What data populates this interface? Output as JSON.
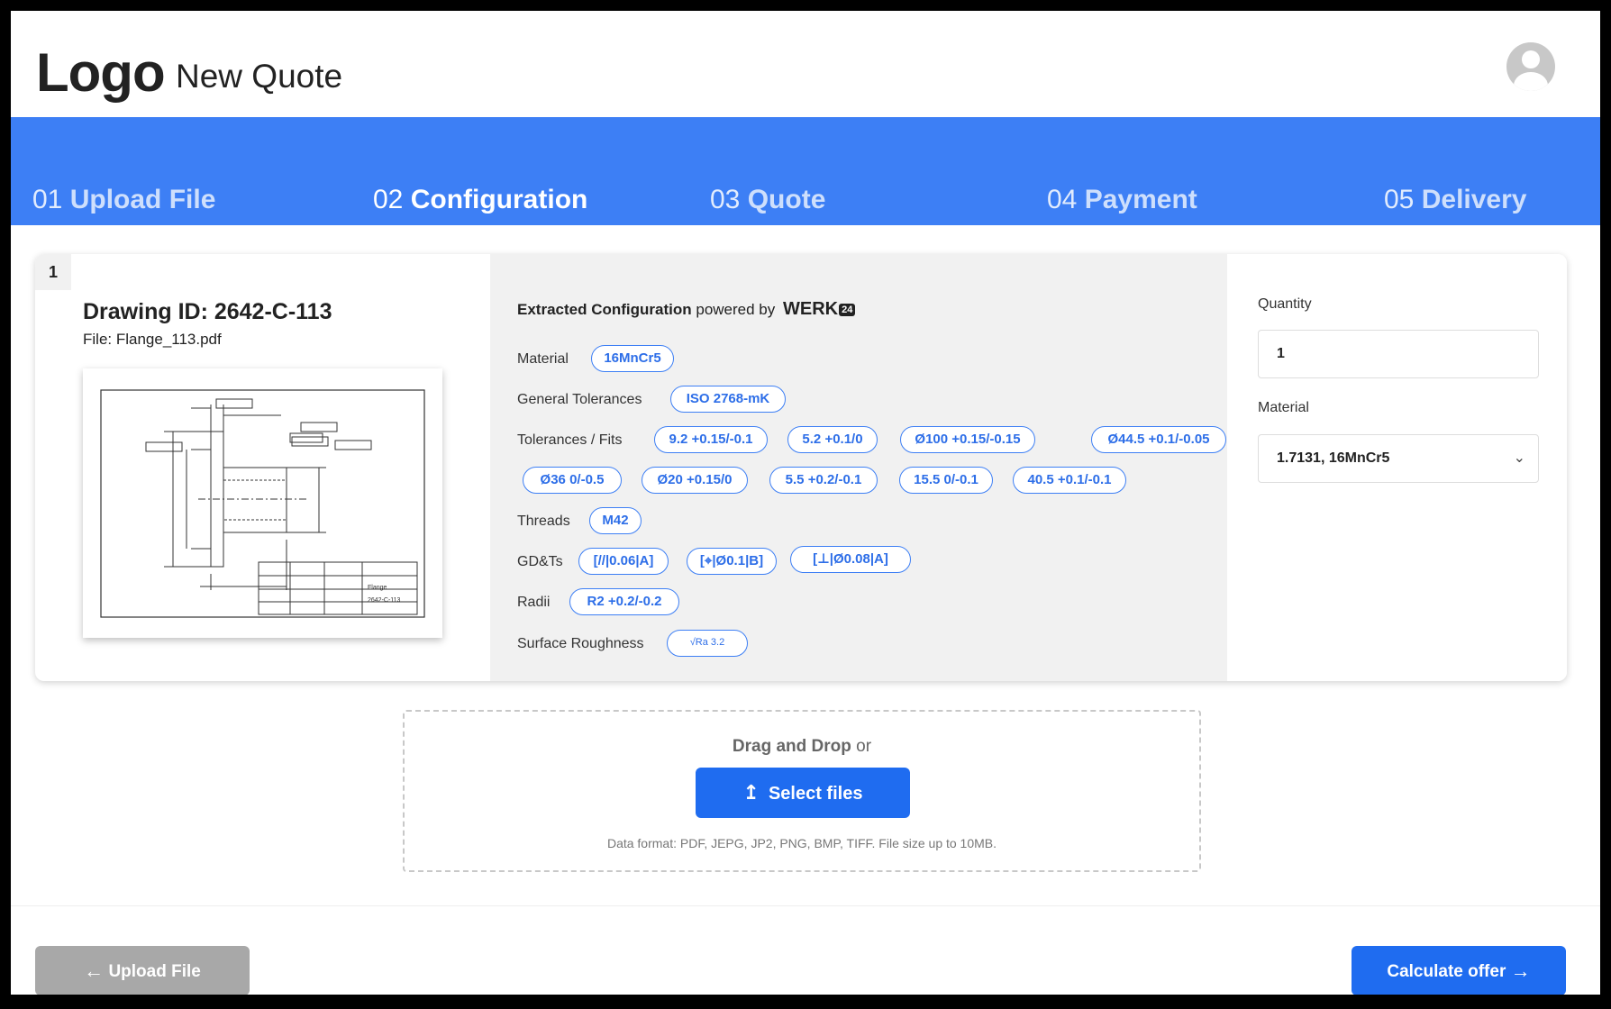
{
  "header": {
    "logo": "Logo",
    "title": "New Quote",
    "avatar_icon": "user-avatar-icon"
  },
  "steps": [
    {
      "num": "01",
      "label": "Upload File",
      "active": false
    },
    {
      "num": "02",
      "label": "Configuration",
      "active": true
    },
    {
      "num": "03",
      "label": "Quote",
      "active": false
    },
    {
      "num": "04",
      "label": "Payment",
      "active": false
    },
    {
      "num": "05",
      "label": "Delivery",
      "active": false
    }
  ],
  "item": {
    "number": "1",
    "drawing_id": "Drawing ID: 2642-C-113",
    "file": "File: Flange_113.pdf",
    "thumbnail_title": "Flange",
    "thumbnail_number": "2642-C-113"
  },
  "config": {
    "heading_bold": "Extracted Configuration",
    "heading_rest": "powered by",
    "brand": "WERK",
    "brand_badge": "24",
    "rows": {
      "material": {
        "label": "Material",
        "chips": [
          "16MnCr5"
        ]
      },
      "general_tolerances": {
        "label": "General Tolerances",
        "chips": [
          "ISO 2768-mK"
        ]
      },
      "tolerances_fits": {
        "label": "Tolerances / Fits",
        "chips": [
          "9.2 +0.15/-0.1",
          "5.2 +0.1/0",
          "Ø100 +0.15/-0.15",
          "Ø44.5 +0.1/-0.05",
          "Ø36 0/-0.5",
          "Ø20 +0.15/0",
          "5.5 +0.2/-0.1",
          "15.5 0/-0.1",
          "40.5 +0.1/-0.1"
        ]
      },
      "threads": {
        "label": "Threads",
        "chips": [
          "M42"
        ]
      },
      "gdts": {
        "label": "GD&Ts",
        "chips": [
          "[//|0.06|A]",
          "[⌖|Ø0.1|B]",
          "[⊥|Ø0.08|A]"
        ]
      },
      "radii": {
        "label": "Radii",
        "chips": [
          "R2 +0.2/-0.2"
        ]
      },
      "surface_roughness": {
        "label": "Surface Roughness",
        "chips": [
          "√Ra 3.2"
        ]
      }
    }
  },
  "side": {
    "quantity_label": "Quantity",
    "quantity_value": "1",
    "material_label": "Material",
    "material_value": "1.7131, 16MnCr5"
  },
  "dropzone": {
    "drag_text": "Drag and Drop",
    "or_text": "or",
    "button_label": "Select files",
    "note": "Data format: PDF, JEPG, JP2, PNG, BMP, TIFF. File size up to 10MB."
  },
  "footer": {
    "back_label": "Upload File",
    "next_label": "Calculate offer"
  },
  "colors": {
    "accent": "#3d7ff5",
    "button": "#1f6cf0",
    "disabled": "#a8a8a8",
    "panel": "#f1f1f1"
  }
}
